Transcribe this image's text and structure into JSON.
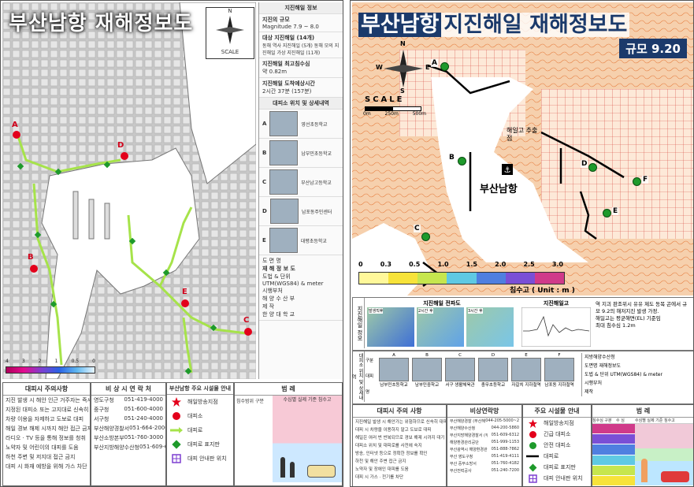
{
  "left": {
    "title": "부산남항 재해정보도",
    "scale_text": "SCALE",
    "compass_n": "N",
    "info": {
      "header": "지진해일 정보",
      "items": [
        {
          "label": "지진의 규모",
          "value": "Magnitude 7.9 ~ 8.0"
        },
        {
          "label": "대상 지진해일 (14개)",
          "value": "동해 역사 지진해일 (5개) 동해 모의 지진해일 가상 지진해일 (11개)"
        },
        {
          "label": "지진해일 최고침수심",
          "value": "약 0.82m"
        },
        {
          "label": "지진해일 도착예상시간",
          "value": "2시간 37분 (157분)"
        }
      ]
    },
    "shelters_header": "대피소 위치 및 상세내역",
    "shelters": [
      {
        "id": "A",
        "name": "영선초등학교"
      },
      {
        "id": "B",
        "name": "남부민초등학교"
      },
      {
        "id": "C",
        "name": "부산남고등학교"
      },
      {
        "id": "D",
        "name": "남포동주민센터"
      },
      {
        "id": "E",
        "name": "대평초등학교"
      }
    ],
    "doc_name_label": "도 면 명",
    "doc_name": "재 해 정 보 도",
    "projection_label": "도법 & 단위",
    "projection": "UTM(WGS84) & meter",
    "agency_label": "시행부처",
    "agency": "해 양 수 산 부",
    "maker_label": "제 작",
    "maker": "한 양 대 학 교",
    "depth_ticks": [
      "4",
      "3",
      "2",
      "1",
      "0.5",
      "0"
    ],
    "markers": [
      "A",
      "B",
      "C",
      "D",
      "E"
    ],
    "caution_header": "대피시 주의사항",
    "caution_lines": [
      "지진 발생 시 해안 인근 거주자는 즉시 대피",
      "지정된 대피소 또는 고지대로 신속히 이동",
      "차량 이용을 자제하고 도보로 대피",
      "해일 경보 해제 시까지 해안 접근 금지",
      "라디오 · TV 등을 통해 정보를 청취",
      "노약자 및 어린이의 대피를 도움",
      "하천 주변 및 저지대 접근 금지",
      "대피 시 화재 예방을 위해 가스 차단"
    ],
    "contact_header": "비 상 시 연 락 처",
    "contacts": [
      {
        "org": "영도구청",
        "tel": "051-419-4000"
      },
      {
        "org": "중구청",
        "tel": "051-600-4000"
      },
      {
        "org": "서구청",
        "tel": "051-240-4000"
      },
      {
        "org": "부산해양경찰서",
        "tel": "051-664-2000"
      },
      {
        "org": "부산소방본부",
        "tel": "051-760-3000"
      },
      {
        "org": "부산지방해양수산청",
        "tel": "051-609-6114"
      }
    ],
    "facility_header": "부산남항 주요 시설물 안내",
    "facilities": [
      "해일방송지점",
      "대피소",
      "대피로",
      "대피로 표지판",
      "대피 안내판 위치"
    ],
    "legend_header": "범 례",
    "legend_sub": "침수범위 구분",
    "legend_right": "수심별 실제 기준 침수고"
  },
  "right": {
    "title_part1": "부산남항",
    "title_part2": "지진해일 재해정보도",
    "scale_badge": "규모 9.20",
    "scale_text": "SCALE",
    "scale_ticks": [
      "0m",
      "250m",
      "500m"
    ],
    "compass": {
      "n": "N",
      "s": "S",
      "e": "E",
      "w": "W"
    },
    "place_label": "부산남항",
    "source_label": "해일고 추출점",
    "markers": [
      "A",
      "B",
      "C",
      "D",
      "E",
      "F"
    ],
    "depth_ticks": [
      "0",
      "0.3",
      "0.5",
      "1.0",
      "1.5",
      "2.0",
      "2.5",
      "3.0"
    ],
    "depth_unit": "침수고 ( Unit : m )",
    "info_side_label": "지진해일 정보",
    "info_col1": "지진해일 전파도",
    "info_col2": "지진해일고",
    "prop_times": [
      "발생직후",
      "2시간 후",
      "3시간 후"
    ],
    "info_notes": [
      "역 지괴 판조위시 유유 제도 동목 곤에서 규모 9.2의 해저지진 발생 가정.",
      "해일고는 평균해면(EL) 기준임",
      "최대 침수심 1.2m"
    ],
    "shelter_side_label": "대피소 위치 및 상세내역",
    "shelter_rows": [
      "구분",
      "대피명",
      "특징"
    ],
    "shelter_ids": [
      "A",
      "B",
      "C",
      "D",
      "E",
      "F"
    ],
    "shelter_names": [
      "남부민초등학교",
      "남부민중학교",
      "서구 생활체육관",
      "충무초등학교",
      "자갈치 지하철역",
      "남포동 지하철역"
    ],
    "right_panel_items": [
      "지방해양수산청",
      "도면명 재해정보도",
      "도법 & 단위 UTM(WGS84) & meter",
      "시행부처",
      "제작"
    ],
    "caution_header": "대피시 주의 사항",
    "caution_lines": [
      "지진해일 발생 시 해안가는 위험하므로 신속히 대피",
      "대피 시 차량을 이용하지 말고 도보로 대피",
      "해일은 여러 번 반복되므로 경보 해제 시까지 대기",
      "대피소 위치 및 대피로를 사전에 숙지",
      "방송, 인터넷 등으로 정확한 정보를 확인",
      "하천 및 해안 주변 접근 금지",
      "노약자 및 장애인 대피를 도움",
      "대피 시 가스 · 전기를 차단"
    ],
    "contact_header": "비상연락망",
    "contacts": [
      {
        "org": "부산해양경찰 (부산해양경비안전서)",
        "tel": "044-205-5000~2"
      },
      {
        "org": "부산해양수산청",
        "tel": "044-200-5860"
      },
      {
        "org": "부산지방해양경찰서 (부산해양경비안전서)",
        "tel": "051-609-6312"
      },
      {
        "org": "해양환경관리공단",
        "tel": "051-999-1153"
      },
      {
        "org": "부산광역시 해양환경관",
        "tel": "051-888-7862"
      },
      {
        "org": "부산 영도구청",
        "tel": "051-419-4111"
      },
      {
        "org": "부산 중부소방서",
        "tel": "051-760-4182"
      },
      {
        "org": "부산전력공사",
        "tel": "051-240-7200"
      }
    ],
    "facility_header": "주요 시설물 안내",
    "facilities": [
      "해일방송지점",
      "긴급 대피소",
      "안전 대피소",
      "대피로",
      "대피로 표지판",
      "대피 안내판 위치"
    ],
    "legend_header": "범 례",
    "legend_col1": "침수심 구분",
    "legend_col2": "수 심",
    "legend_col3": "수심별 실제 기준 침수고"
  }
}
